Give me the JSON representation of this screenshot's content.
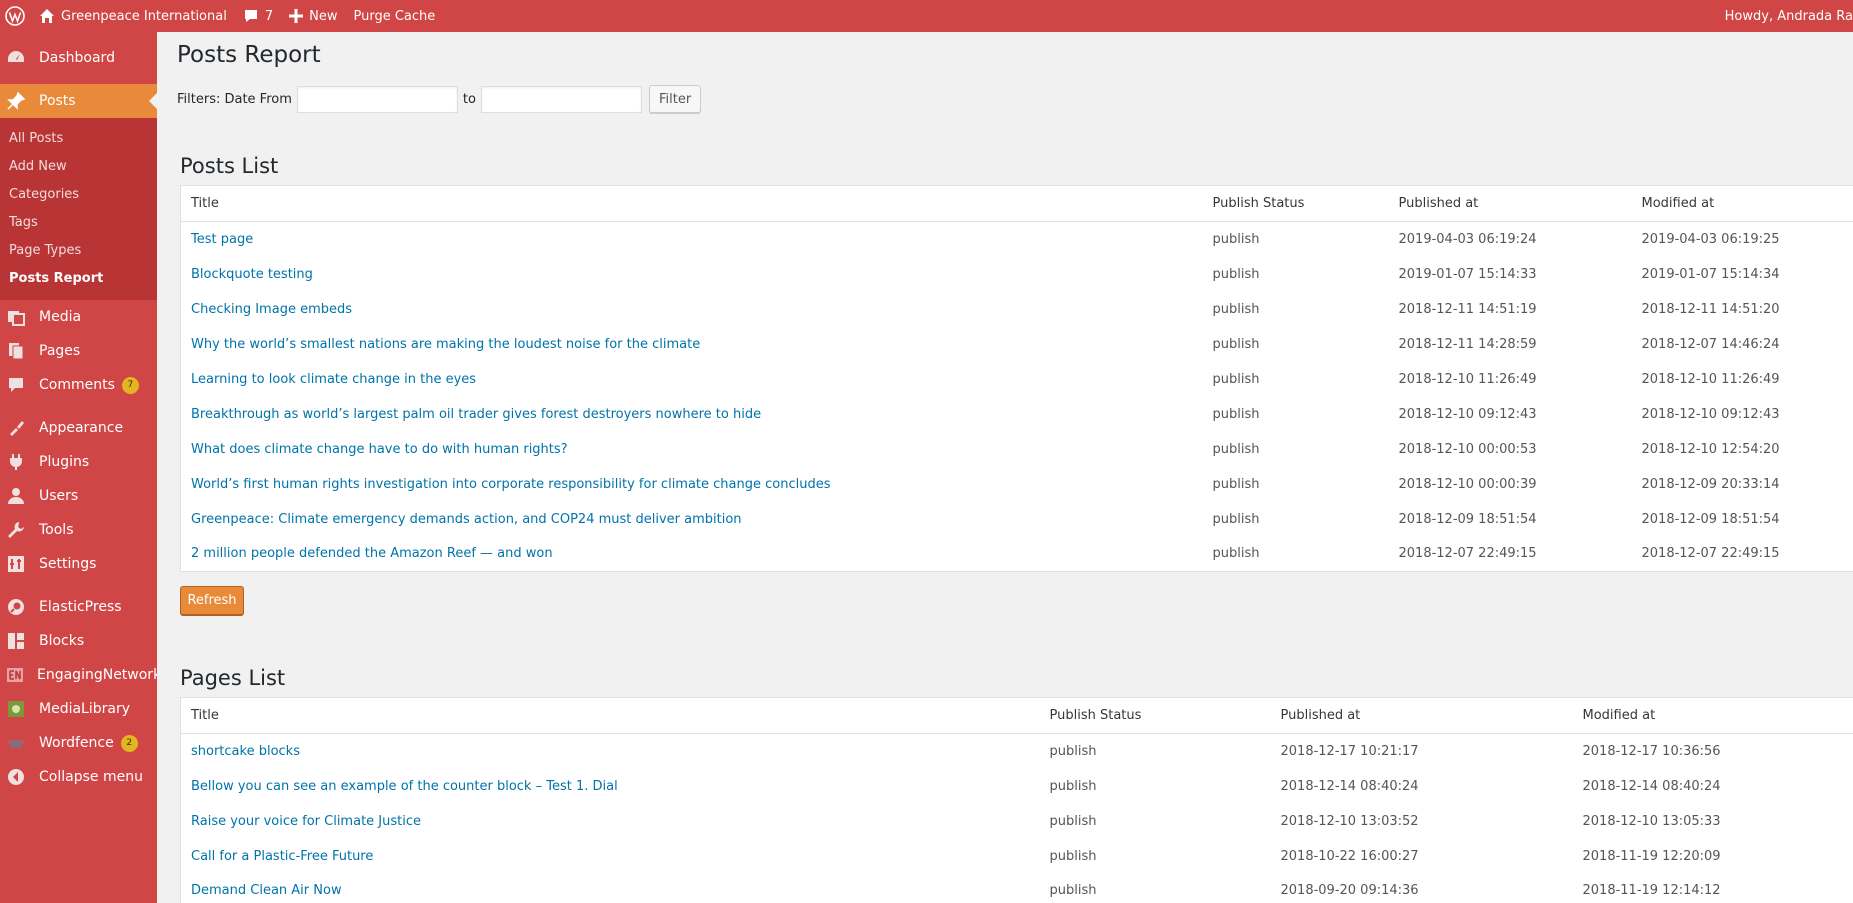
{
  "adminbar": {
    "site_name": "Greenpeace International",
    "comments_count": "7",
    "new_label": "New",
    "purge_label": "Purge Cache",
    "howdy": "Howdy, Andrada Ra"
  },
  "sidebar": {
    "dashboard": "Dashboard",
    "posts": "Posts",
    "posts_sub": [
      "All Posts",
      "Add New",
      "Categories",
      "Tags",
      "Page Types",
      "Posts Report"
    ],
    "media": "Media",
    "pages": "Pages",
    "comments": "Comments",
    "comments_badge": "7",
    "appearance": "Appearance",
    "plugins": "Plugins",
    "users": "Users",
    "tools": "Tools",
    "settings": "Settings",
    "elasticpress": "ElasticPress",
    "blocks": "Blocks",
    "engagingnetworks": "EngagingNetworks",
    "medialibrary": "MediaLibrary",
    "wordfence": "Wordfence",
    "wordfence_badge": "2",
    "collapse": "Collapse menu"
  },
  "main": {
    "page_title": "Posts Report",
    "filters_label": "Filters: Date From",
    "to_label": "to",
    "date_from_value": "",
    "date_to_value": "",
    "filter_button": "Filter",
    "refresh_button": "Refresh"
  },
  "posts_list": {
    "heading": "Posts List",
    "columns": [
      "Title",
      "Publish Status",
      "Published at",
      "Modified at"
    ],
    "rows": [
      [
        "Test page",
        "publish",
        "2019-04-03 06:19:24",
        "2019-04-03 06:19:25"
      ],
      [
        "Blockquote testing",
        "publish",
        "2019-01-07 15:14:33",
        "2019-01-07 15:14:34"
      ],
      [
        "Checking Image embeds",
        "publish",
        "2018-12-11 14:51:19",
        "2018-12-11 14:51:20"
      ],
      [
        "Why the world’s smallest nations are making the loudest noise for the climate",
        "publish",
        "2018-12-11 14:28:59",
        "2018-12-07 14:46:24"
      ],
      [
        "Learning to look climate change in the eyes",
        "publish",
        "2018-12-10 11:26:49",
        "2018-12-10 11:26:49"
      ],
      [
        "Breakthrough as world’s largest palm oil trader gives forest destroyers nowhere to hide",
        "publish",
        "2018-12-10 09:12:43",
        "2018-12-10 09:12:43"
      ],
      [
        "What does climate change have to do with human rights?",
        "publish",
        "2018-12-10 00:00:53",
        "2018-12-10 12:54:20"
      ],
      [
        "World’s first human rights investigation into corporate responsibility for climate change concludes",
        "publish",
        "2018-12-10 00:00:39",
        "2018-12-09 20:33:14"
      ],
      [
        "Greenpeace: Climate emergency demands action, and COP24 must deliver ambition",
        "publish",
        "2018-12-09 18:51:54",
        "2018-12-09 18:51:54"
      ],
      [
        "2 million people defended the Amazon Reef — and won",
        "publish",
        "2018-12-07 22:49:15",
        "2018-12-07 22:49:15"
      ]
    ]
  },
  "pages_list": {
    "heading": "Pages List",
    "columns": [
      "Title",
      "Publish Status",
      "Published at",
      "Modified at"
    ],
    "rows": [
      [
        "shortcake blocks",
        "publish",
        "2018-12-17 10:21:17",
        "2018-12-17 10:36:56"
      ],
      [
        "Bellow you can see an example of the counter block – Test 1. Dial",
        "publish",
        "2018-12-14 08:40:24",
        "2018-12-14 08:40:24"
      ],
      [
        "Raise your voice for Climate Justice",
        "publish",
        "2018-12-10 13:03:52",
        "2018-12-10 13:05:33"
      ],
      [
        "Call for a Plastic-Free Future",
        "publish",
        "2018-10-22 16:00:27",
        "2018-11-19 12:20:09"
      ],
      [
        "Demand Clean Air Now",
        "publish",
        "2018-09-20 09:14:36",
        "2018-11-19 12:14:12"
      ]
    ]
  },
  "colors": {
    "adminbar_bg": "#d04646",
    "sidebar_bg": "#d04646",
    "submenu_bg": "#b93535",
    "accent_orange": "#e88a3a",
    "link": "#0073aa",
    "badge": "#e3b521"
  },
  "icons": [
    "wordpress-logo-icon",
    "home-icon",
    "comment-bubble-icon",
    "plus-icon",
    "dashboard-icon",
    "pin-icon",
    "media-icon",
    "pages-icon",
    "comments-icon",
    "appearance-icon",
    "plugins-icon",
    "users-icon",
    "tools-icon",
    "settings-icon",
    "elasticpress-icon",
    "blocks-icon",
    "engagingnetworks-icon",
    "medialibrary-icon",
    "wordfence-icon",
    "collapse-icon"
  ]
}
